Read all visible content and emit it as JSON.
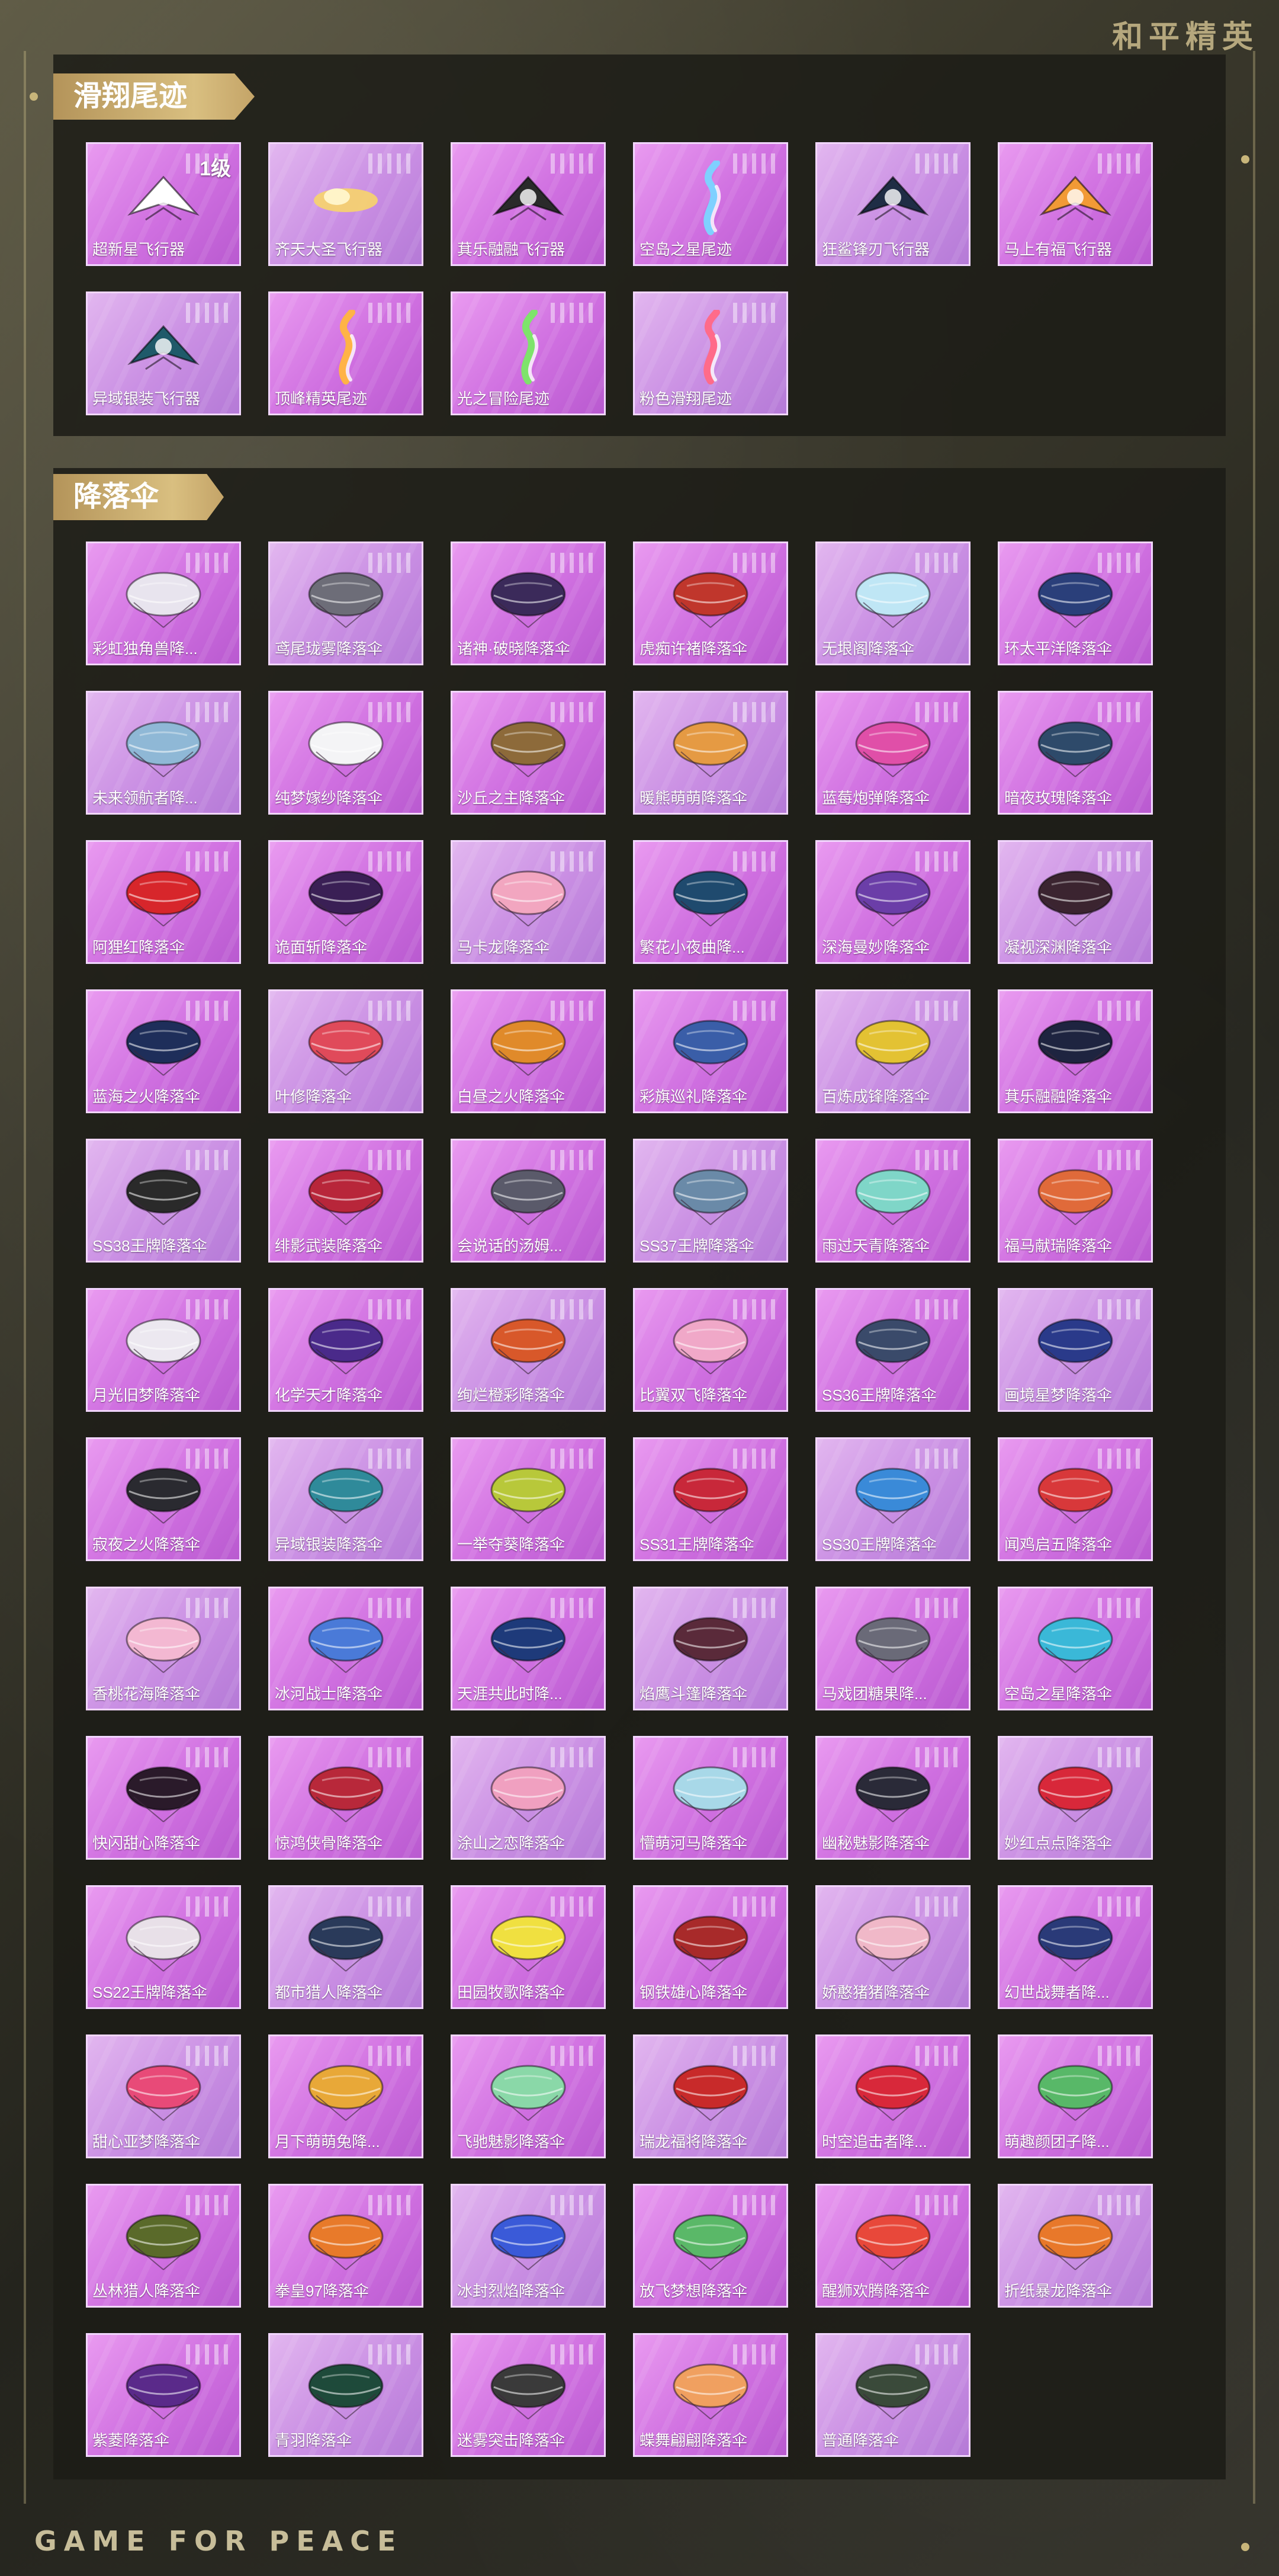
{
  "brand": {
    "logo": "和平精英",
    "footer": "GAME FOR PEACE"
  },
  "sections": [
    {
      "title": "滑翔尾迹",
      "items": [
        {
          "label": "超新星飞行器",
          "level": "1级",
          "icon": "jet-glider-icon",
          "color": "#ffffff"
        },
        {
          "label": "齐天大圣飞行器",
          "icon": "cloud-glider-icon",
          "color": "#f7d46a"
        },
        {
          "label": "萁乐融融飞行器",
          "icon": "penguin-glider-icon",
          "color": "#2a2a2a"
        },
        {
          "label": "空岛之星尾迹",
          "icon": "trail-icon",
          "color": "#7fd0ff"
        },
        {
          "label": "狂鲨锋刃飞行器",
          "icon": "shark-glider-icon",
          "color": "#1f2d45"
        },
        {
          "label": "马上有福飞行器",
          "icon": "horse-glider-icon",
          "color": "#f29a36"
        },
        {
          "label": "异域银装飞行器",
          "icon": "dragon-glider-icon",
          "color": "#1f5a6a"
        },
        {
          "label": "顶峰精英尾迹",
          "icon": "trail-icon",
          "color": "#ffb347"
        },
        {
          "label": "光之冒险尾迹",
          "icon": "trail-icon",
          "color": "#7ee36b"
        },
        {
          "label": "粉色滑翔尾迹",
          "icon": "trail-icon",
          "color": "#ff6b8a"
        }
      ]
    },
    {
      "title": "降落伞",
      "items": [
        {
          "label": "彩虹独角兽降...",
          "icon": "parachute-icon",
          "color": "#e8e4ee"
        },
        {
          "label": "鸢尾珑雾降落伞",
          "icon": "parachute-icon",
          "color": "#6d6d78"
        },
        {
          "label": "诸神·破晓降落伞",
          "icon": "parachute-icon",
          "color": "#3b2a5a"
        },
        {
          "label": "虎痴许褚降落伞",
          "icon": "parachute-icon",
          "color": "#c0362c"
        },
        {
          "label": "无垠阁降落伞",
          "icon": "parachute-icon",
          "color": "#bfe6f5"
        },
        {
          "label": "环太平洋降落伞",
          "icon": "parachute-icon",
          "color": "#2a3f7a"
        },
        {
          "label": "未来领航者降...",
          "icon": "parachute-icon",
          "color": "#8fb8d6"
        },
        {
          "label": "纯梦嫁纱降落伞",
          "icon": "parachute-icon",
          "color": "#f4f4f6"
        },
        {
          "label": "沙丘之主降落伞",
          "icon": "parachute-icon",
          "color": "#8d6a3a"
        },
        {
          "label": "暖熊萌萌降落伞",
          "icon": "parachute-icon",
          "color": "#e59a43"
        },
        {
          "label": "蓝莓炮弹降落伞",
          "icon": "parachute-icon",
          "color": "#e04fa8"
        },
        {
          "label": "暗夜玫瑰降落伞",
          "icon": "parachute-icon",
          "color": "#2e4a6a"
        },
        {
          "label": "阿狸红降落伞",
          "icon": "parachute-icon",
          "color": "#d7262b"
        },
        {
          "label": "诡面斩降落伞",
          "icon": "parachute-icon",
          "color": "#3a1f55"
        },
        {
          "label": "马卡龙降落伞",
          "icon": "parachute-icon",
          "color": "#f2a6c0"
        },
        {
          "label": "繁花小夜曲降...",
          "icon": "parachute-icon",
          "color": "#1f4a6e"
        },
        {
          "label": "深海曼妙降落伞",
          "icon": "parachute-icon",
          "color": "#6b3ea8"
        },
        {
          "label": "凝视深渊降落伞",
          "icon": "parachute-icon",
          "color": "#3b2430"
        },
        {
          "label": "蓝海之火降落伞",
          "icon": "parachute-icon",
          "color": "#1e2e5a"
        },
        {
          "label": "叶修降落伞",
          "icon": "parachute-icon",
          "color": "#e04a5a"
        },
        {
          "label": "白昼之火降落伞",
          "icon": "parachute-icon",
          "color": "#e08a2a"
        },
        {
          "label": "彩旗巡礼降落伞",
          "icon": "parachute-icon",
          "color": "#3a5ea8"
        },
        {
          "label": "百炼成锋降落伞",
          "icon": "parachute-icon",
          "color": "#e3c233"
        },
        {
          "label": "萁乐融融降落伞",
          "icon": "parachute-icon",
          "color": "#1e2440"
        },
        {
          "label": "SS38王牌降落伞",
          "icon": "parachute-icon",
          "color": "#2a2a2a"
        },
        {
          "label": "绯影武装降落伞",
          "icon": "parachute-icon",
          "color": "#b8263a"
        },
        {
          "label": "会说话的汤姆...",
          "icon": "parachute-icon",
          "color": "#5a5a6a"
        },
        {
          "label": "SS37王牌降落伞",
          "icon": "parachute-icon",
          "color": "#6a8aa8"
        },
        {
          "label": "雨过天青降落伞",
          "icon": "parachute-icon",
          "color": "#7fd6c8"
        },
        {
          "label": "福马献瑞降落伞",
          "icon": "parachute-icon",
          "color": "#e06a3a"
        },
        {
          "label": "月光旧梦降落伞",
          "icon": "parachute-icon",
          "color": "#ece8f0"
        },
        {
          "label": "化学天才降落伞",
          "icon": "parachute-icon",
          "color": "#4a2a8a"
        },
        {
          "label": "绚烂橙彩降落伞",
          "icon": "parachute-icon",
          "color": "#d8582a"
        },
        {
          "label": "比翼双飞降落伞",
          "icon": "parachute-icon",
          "color": "#f0a8c8"
        },
        {
          "label": "SS36王牌降落伞",
          "icon": "parachute-icon",
          "color": "#3a4a6a"
        },
        {
          "label": "画境星梦降落伞",
          "icon": "parachute-icon",
          "color": "#2a3a8a"
        },
        {
          "label": "寂夜之火降落伞",
          "icon": "parachute-icon",
          "color": "#2a2a30"
        },
        {
          "label": "异域银装降落伞",
          "icon": "parachute-icon",
          "color": "#2f8a9a"
        },
        {
          "label": "一举夺葵降落伞",
          "icon": "parachute-icon",
          "color": "#b8c83a"
        },
        {
          "label": "SS31王牌降落伞",
          "icon": "parachute-icon",
          "color": "#c8283a"
        },
        {
          "label": "SS30王牌降落伞",
          "icon": "parachute-icon",
          "color": "#3a8ad8"
        },
        {
          "label": "闻鸡启五降落伞",
          "icon": "parachute-icon",
          "color": "#d8383a"
        },
        {
          "label": "香桃花海降落伞",
          "icon": "parachute-icon",
          "color": "#f3b8d2"
        },
        {
          "label": "冰河战士降落伞",
          "icon": "parachute-icon",
          "color": "#4a7ad8"
        },
        {
          "label": "天涯共此时降...",
          "icon": "parachute-icon",
          "color": "#1e3a7a"
        },
        {
          "label": "焰鹰斗篷降落伞",
          "icon": "parachute-icon",
          "color": "#5a2a3a"
        },
        {
          "label": "马戏团糖果降...",
          "icon": "parachute-icon",
          "color": "#6a6a78"
        },
        {
          "label": "空岛之星降落伞",
          "icon": "parachute-icon",
          "color": "#3ab8d8"
        },
        {
          "label": "快闪甜心降落伞",
          "icon": "parachute-icon",
          "color": "#2a1a2a"
        },
        {
          "label": "惊鸿侠骨降落伞",
          "icon": "parachute-icon",
          "color": "#b8283a"
        },
        {
          "label": "涂山之恋降落伞",
          "icon": "parachute-icon",
          "color": "#f0a0c0"
        },
        {
          "label": "懵萌河马降落伞",
          "icon": "parachute-icon",
          "color": "#a8d8e8"
        },
        {
          "label": "幽秘魅影降落伞",
          "icon": "parachute-icon",
          "color": "#2a2a38"
        },
        {
          "label": "妙红点点降落伞",
          "icon": "parachute-icon",
          "color": "#d8283a"
        },
        {
          "label": "SS22王牌降落伞",
          "icon": "parachute-icon",
          "color": "#e8e0e8"
        },
        {
          "label": "都市猎人降落伞",
          "icon": "parachute-icon",
          "color": "#2a3a5a"
        },
        {
          "label": "田园牧歌降落伞",
          "icon": "parachute-icon",
          "color": "#f0e040"
        },
        {
          "label": "钢铁雄心降落伞",
          "icon": "parachute-icon",
          "color": "#a82a2a"
        },
        {
          "label": "娇憨猪猪降落伞",
          "icon": "parachute-icon",
          "color": "#f0b8c8"
        },
        {
          "label": "幻世战舞者降...",
          "icon": "parachute-icon",
          "color": "#2a3a78"
        },
        {
          "label": "甜心亚梦降落伞",
          "icon": "parachute-icon",
          "color": "#e84a78"
        },
        {
          "label": "月下萌萌兔降...",
          "icon": "parachute-icon",
          "color": "#e8a838"
        },
        {
          "label": "飞驰魅影降落伞",
          "icon": "parachute-icon",
          "color": "#8ad8a8"
        },
        {
          "label": "瑞龙福将降落伞",
          "icon": "parachute-icon",
          "color": "#c82a2a"
        },
        {
          "label": "时空追击者降...",
          "icon": "parachute-icon",
          "color": "#d8283a"
        },
        {
          "label": "萌趣颜团子降...",
          "icon": "parachute-icon",
          "color": "#58b868"
        },
        {
          "label": "丛林猎人降落伞",
          "icon": "parachute-icon",
          "color": "#5a6a2a"
        },
        {
          "label": "拳皇97降落伞",
          "icon": "parachute-icon",
          "color": "#e87a2a"
        },
        {
          "label": "冰封烈焰降落伞",
          "icon": "parachute-icon",
          "color": "#3a5ad8"
        },
        {
          "label": "放飞梦想降落伞",
          "icon": "parachute-icon",
          "color": "#5ab868"
        },
        {
          "label": "醒狮欢腾降落伞",
          "icon": "parachute-icon",
          "color": "#e8483a"
        },
        {
          "label": "折纸暴龙降落伞",
          "icon": "parachute-icon",
          "color": "#e8782a"
        },
        {
          "label": "紫菱降落伞",
          "icon": "parachute-icon",
          "color": "#5a2a8a"
        },
        {
          "label": "青羽降落伞",
          "icon": "parachute-icon",
          "color": "#1e4a3a"
        },
        {
          "label": "迷雾突击降落伞",
          "icon": "parachute-icon",
          "color": "#3a3a3a"
        },
        {
          "label": "蝶舞翩翩降落伞",
          "icon": "parachute-icon",
          "color": "#f0a060"
        },
        {
          "label": "普通降落伞",
          "icon": "parachute-icon",
          "color": "#3a4a3a"
        }
      ]
    }
  ]
}
